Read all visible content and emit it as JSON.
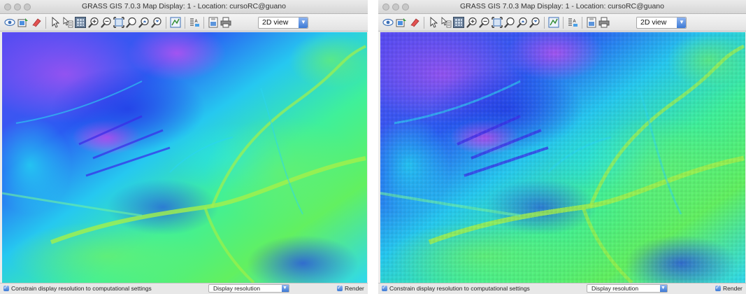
{
  "windows": [
    {
      "id": "left",
      "title": "GRASS GIS 7.0.3 Map Display: 1  - Location: cursoRC@guano",
      "view_selector": {
        "value": "2D view",
        "arrow": "chevron-down-icon"
      },
      "status": {
        "constrain_label": "Constrain display resolution to computational settings",
        "constrain_checked": true,
        "resolution_value": "Display resolution",
        "render_label": "Render",
        "render_checked": true
      },
      "map": {
        "variant": "smooth"
      }
    },
    {
      "id": "right",
      "title": "GRASS GIS 7.0.3 Map Display: 1  - Location: cursoRC@guano",
      "view_selector": {
        "value": "2D view",
        "arrow": "chevron-down-icon"
      },
      "status": {
        "constrain_label": "Constrain display resolution to computational settings",
        "constrain_checked": true,
        "resolution_value": "Display resolution",
        "render_label": "Render",
        "render_checked": true
      },
      "map": {
        "variant": "pixelated"
      }
    }
  ],
  "toolbar_icons": [
    "display-map-icon",
    "render-map-icon",
    "erase-display-icon",
    "pointer-icon",
    "query-icon",
    "pan-icon",
    "zoom-in-icon",
    "zoom-out-icon",
    "zoom-extent-icon",
    "zoom-back-icon",
    "zoom-menu-icon",
    "zoom-region-icon",
    "analyze-icon",
    "decoration-icon",
    "save-image-icon",
    "print-icon"
  ],
  "colors": {
    "elevation_low": "#2a6bf0",
    "elevation_mid": "#27e3ef",
    "elevation_high": "#3df07a",
    "ridge_low": "#1f2ee0",
    "ridge_peak": "#c845f0",
    "accent": "#3d7ad6"
  }
}
